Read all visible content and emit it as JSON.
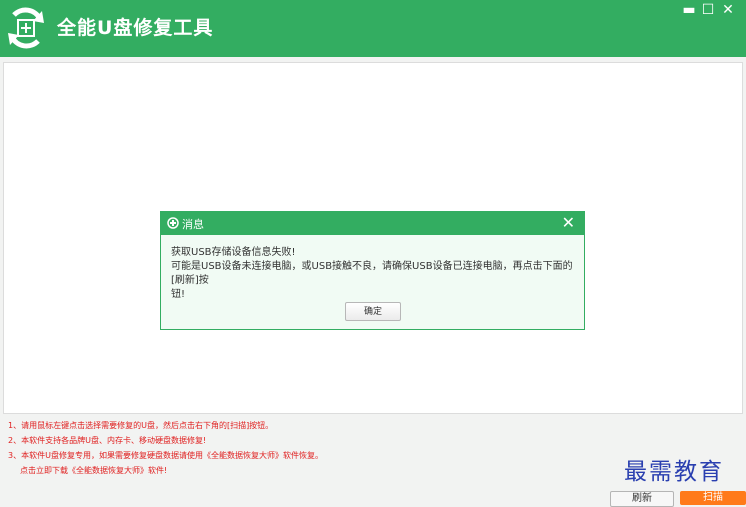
{
  "app": {
    "title": "全能U盘修复工具",
    "brand_color": "#33ad61"
  },
  "window_controls": {
    "minimize": "▬",
    "maximize": "☐",
    "close": "✕"
  },
  "dialog": {
    "title": "消息",
    "close_glyph": "✕",
    "message_line1": "获取USB存储设备信息失败!",
    "message_line2": "可能是USB设备未连接电脑，或USB接触不良，请确保USB设备已连接电脑，再点击下面的[刷新]按",
    "message_line3": "钮!",
    "ok_label": "确定"
  },
  "notes": {
    "line1": "1、请用鼠标左键点击选择需要修复的U盘，然后点击右下角的[扫描]按钮。",
    "line2": "2、本软件支持各品牌U盘、内存卡、移动硬盘数据修复!",
    "line3": "3、本软件U盘修复专用，如果需要修复硬盘数据请使用《全能数据恢复大师》软件恢复。",
    "line4": "点击立即下载《全能数据恢复大师》软件!"
  },
  "watermark": "最需教育",
  "buttons": {
    "refresh": "刷新",
    "scan": "扫描"
  }
}
